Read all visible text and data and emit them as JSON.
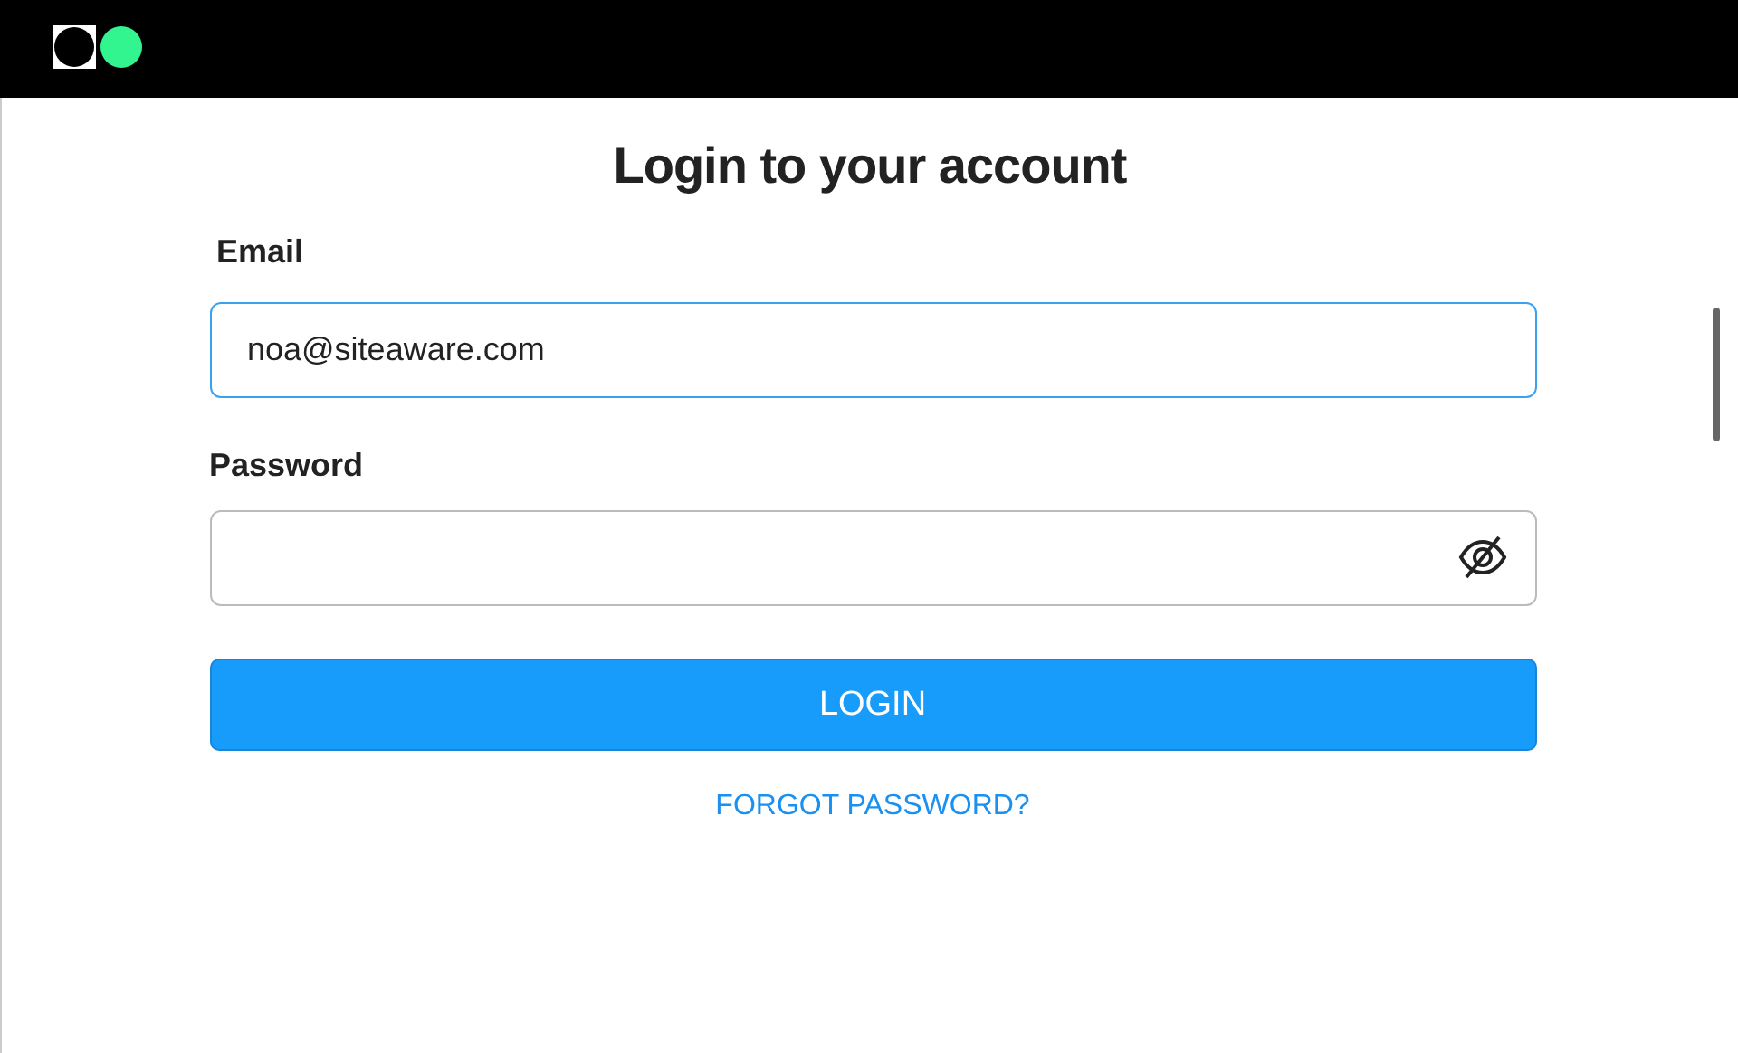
{
  "title": "Login to your account",
  "fields": [
    {
      "label": "Email",
      "value": "noa@siteaware.com",
      "focused": true,
      "kind": "text"
    },
    {
      "label": "Password",
      "focused": false,
      "kind": "password"
    }
  ],
  "login_button": "LOGIN",
  "forgot_link": "FORGOT PASSWORD?"
}
